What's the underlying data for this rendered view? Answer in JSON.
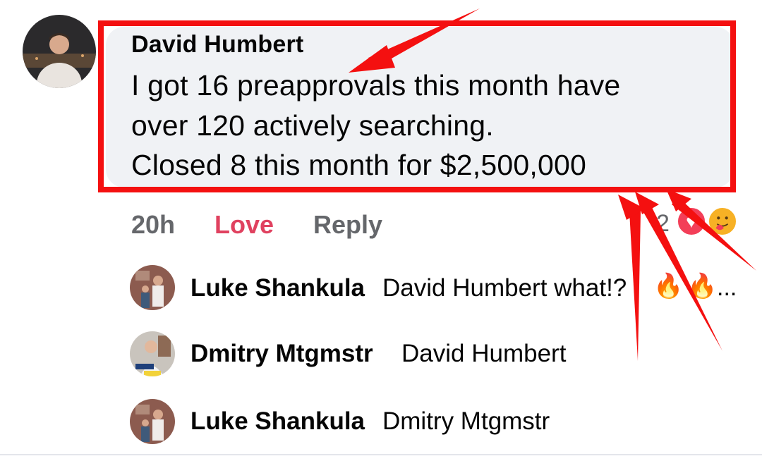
{
  "comment": {
    "author": "David Humbert",
    "lines": [
      "I got 16 preapprovals this month have",
      "over 120 actively searching.",
      "Closed 8 this month for $2,500,000"
    ],
    "time": "20h",
    "love_label": "Love",
    "reply_label": "Reply",
    "reaction_count": "2",
    "reactions": [
      "love-reaction",
      "care-reaction"
    ]
  },
  "replies": [
    {
      "author": "Luke Shankula",
      "text": "David Humbert what!?",
      "emoji": [
        "🔥",
        "🔥"
      ],
      "ellipsis": "..."
    },
    {
      "author": "Dmitry Mtgmstr",
      "text": "David Humbert"
    },
    {
      "author": "Luke Shankula",
      "text": "Dmitry Mtgmstr"
    }
  ],
  "colors": {
    "annotation_red": "#f41010",
    "love_pink": "#e0415f",
    "bubble_bg": "#f0f2f5",
    "meta_gray": "#65676b"
  }
}
